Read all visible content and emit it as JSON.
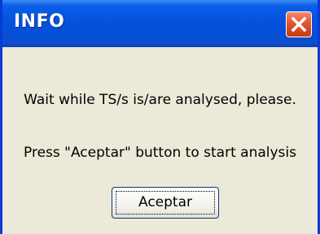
{
  "dialog": {
    "title": "INFO",
    "message_line1": "Wait while TS/s is/are analysed, please.",
    "message_line2": "Press \"Aceptar\" button to start analysis",
    "ok_button_label": "Aceptar",
    "close_icon": "close-icon"
  },
  "colors": {
    "titlebar": "#0552dd",
    "window_body": "#ece9d8",
    "close_button": "#e2552f",
    "frame_border": "#0a3ad8"
  }
}
